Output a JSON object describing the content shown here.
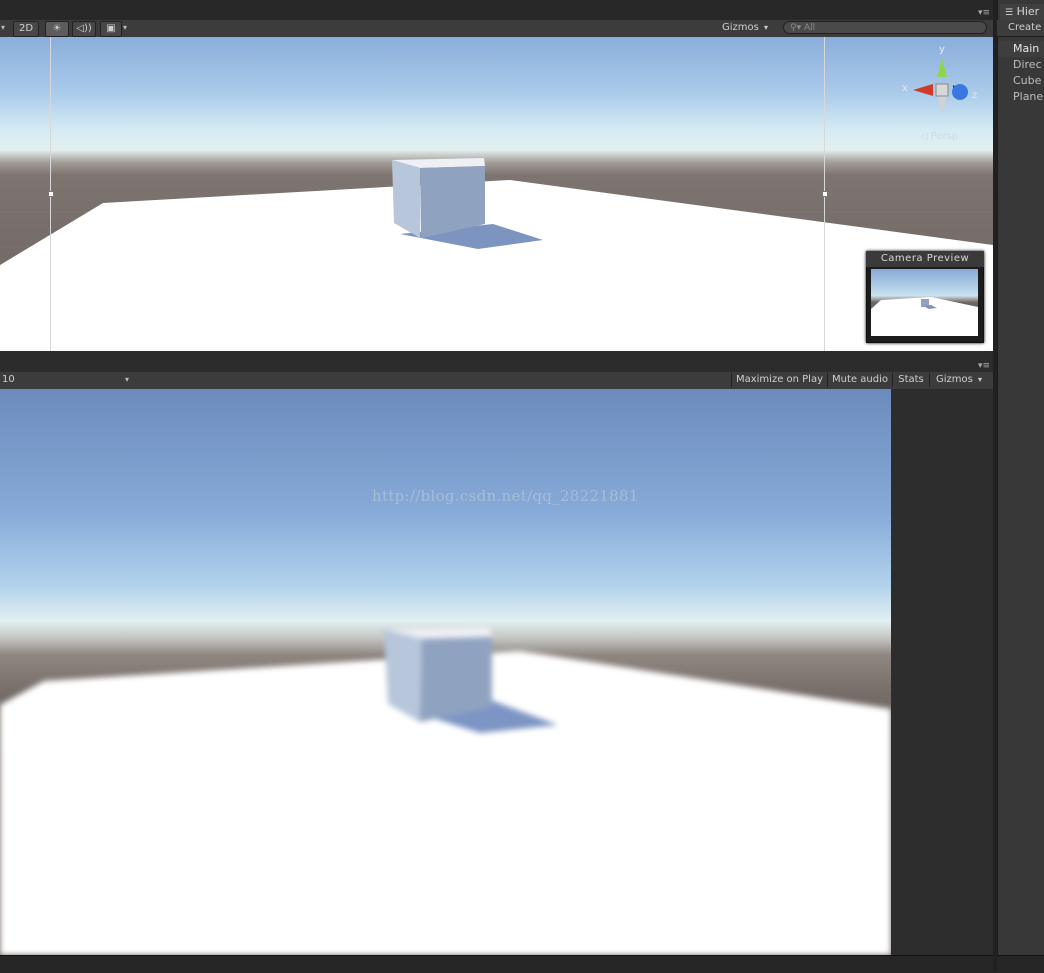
{
  "scene": {
    "toolbar": {
      "mode_2d": "2D",
      "lighting_icon": "sun-icon",
      "audio_icon": "speaker-icon",
      "effects_icon": "image-icon",
      "gizmos_label": "Gizmos",
      "search_placeholder": "All"
    },
    "gizmo": {
      "x_label": "x",
      "y_label": "y",
      "z_label": "z",
      "projection_label": "Persp"
    },
    "camera_preview_title": "Camera Preview"
  },
  "game": {
    "toolbar": {
      "resolution_fragment": "10",
      "maximize_label": "Maximize on Play",
      "mute_label": "Mute audio",
      "stats_label": "Stats",
      "gizmos_label": "Gizmos"
    },
    "watermark": "http://blog.csdn.net/qq_28221881"
  },
  "hierarchy": {
    "tab_label": "Hier",
    "create_label": "Create",
    "items": [
      "Main",
      "Direc",
      "Cube",
      "Plane"
    ]
  },
  "colors": {
    "panel_bg": "#383838",
    "toolbar_bg": "#3c3c3c",
    "sky_top": "#8aaedb",
    "horizon": "#e2efef",
    "ground": "#6a625e",
    "plane": "#ffffff"
  }
}
